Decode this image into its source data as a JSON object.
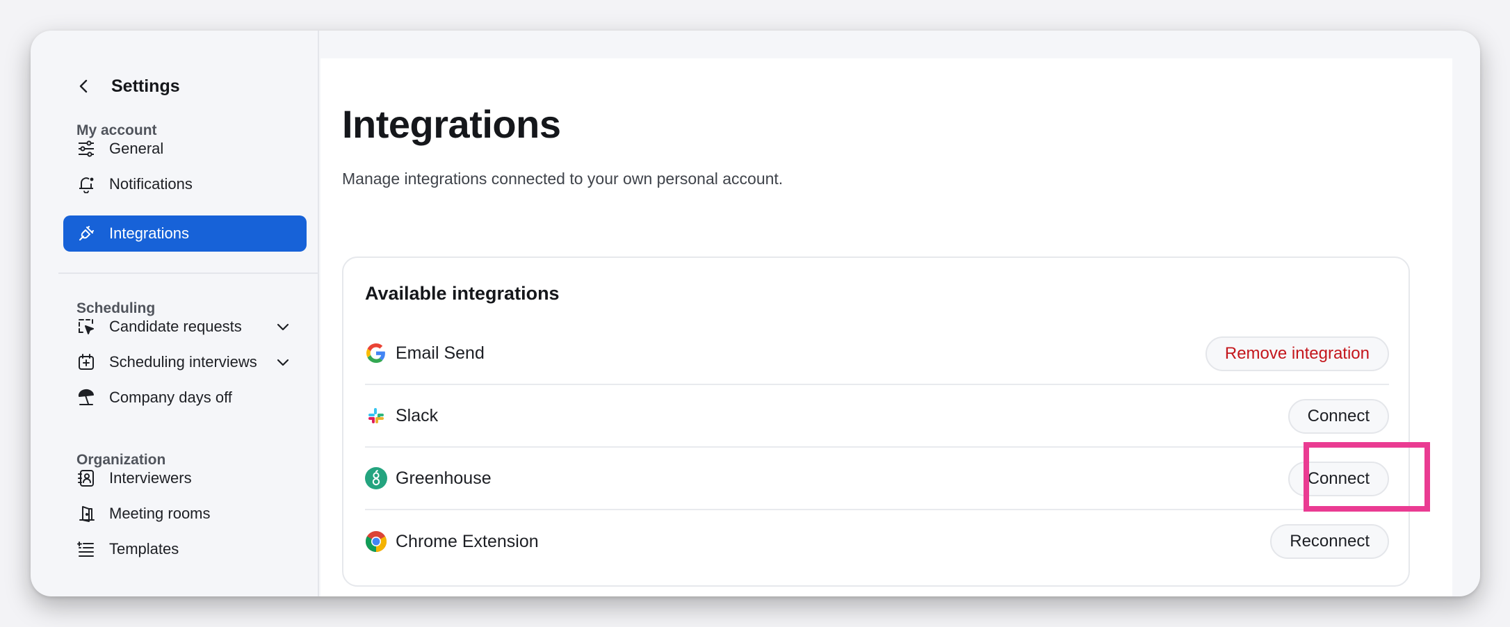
{
  "sidebar": {
    "title": "Settings",
    "sections": {
      "my_account": "My account",
      "scheduling": "Scheduling",
      "organization": "Organization"
    },
    "items": [
      {
        "label": "General",
        "icon": "sliders-icon"
      },
      {
        "label": "Notifications",
        "icon": "bell-icon"
      },
      {
        "label": "Integrations",
        "icon": "plug-icon",
        "active": true
      },
      {
        "label": "Candidate requests",
        "icon": "dashed-select-icon",
        "expandable": true
      },
      {
        "label": "Scheduling interviews",
        "icon": "calendar-plus-icon",
        "expandable": true
      },
      {
        "label": "Company days off",
        "icon": "beach-umbrella-icon"
      },
      {
        "label": "Interviewers",
        "icon": "contact-book-icon"
      },
      {
        "label": "Meeting rooms",
        "icon": "door-icon"
      },
      {
        "label": "Templates",
        "icon": "list-template-icon"
      }
    ]
  },
  "main": {
    "title": "Integrations",
    "subtitle": "Manage integrations connected to your own personal account.",
    "card": {
      "title": "Available integrations",
      "integrations": [
        {
          "name": "Email Send",
          "icon": "google-icon",
          "action": "Remove integration"
        },
        {
          "name": "Slack",
          "icon": "slack-icon",
          "action": "Connect"
        },
        {
          "name": "Greenhouse",
          "icon": "greenhouse-icon",
          "action": "Connect"
        },
        {
          "name": "Chrome Extension",
          "icon": "chrome-icon",
          "action": "Reconnect"
        }
      ]
    }
  },
  "colors": {
    "accent": "#1762d8",
    "danger": "#c4161c",
    "highlight": "#ea3b92",
    "greenhouse": "#24a47f"
  }
}
